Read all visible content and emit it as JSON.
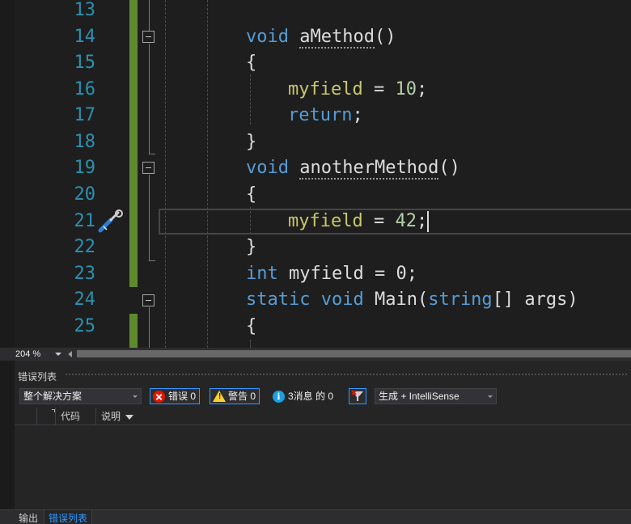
{
  "editor": {
    "line_numbers": [
      "13",
      "14",
      "15",
      "16",
      "17",
      "18",
      "19",
      "20",
      "21",
      "22",
      "23",
      "24",
      "25"
    ],
    "code": {
      "l14_kw": "void",
      "l14_name": "aMethod",
      "l14_rest": "()",
      "l15": "{",
      "l16_field": "myfield",
      "l16_op": " = ",
      "l16_num": "10",
      "l16_end": ";",
      "l17_kw": "return",
      "l17_end": ";",
      "l18": "}",
      "l19_kw": "void",
      "l19_name": "anotherMethod",
      "l19_rest": "()",
      "l20": "{",
      "l21_field": "myfield",
      "l21_op": " = ",
      "l21_num": "42",
      "l21_end": ";",
      "l22": "}",
      "l23_kw": "int",
      "l23_rest": " myfield = 0;",
      "l24_kw1": "static",
      "l24_kw2": "void",
      "l24_name": " Main(",
      "l24_kw3": "string",
      "l24_rest": "[] args)",
      "l25": "{"
    },
    "quick_action_icon": "screwdriver-wrench-icon"
  },
  "zoom": {
    "level": "204 %"
  },
  "error_list": {
    "title": "错误列表",
    "scope": "整个解决方案",
    "errors_label": "错误 0",
    "warnings_label": "警告 0",
    "messages_label": "3消息 的 0",
    "build_source": "生成 + IntelliSense",
    "columns": {
      "code": "代码",
      "description": "说明"
    }
  },
  "tabs": {
    "output": "输出",
    "error_list": "错误列表"
  },
  "colors": {
    "line_number": "#2b91af",
    "keyword": "#569cd6",
    "field": "#c8c86a",
    "number": "#b5cea8",
    "change_bar": "#5e8a2f",
    "accent": "#3399ff"
  }
}
